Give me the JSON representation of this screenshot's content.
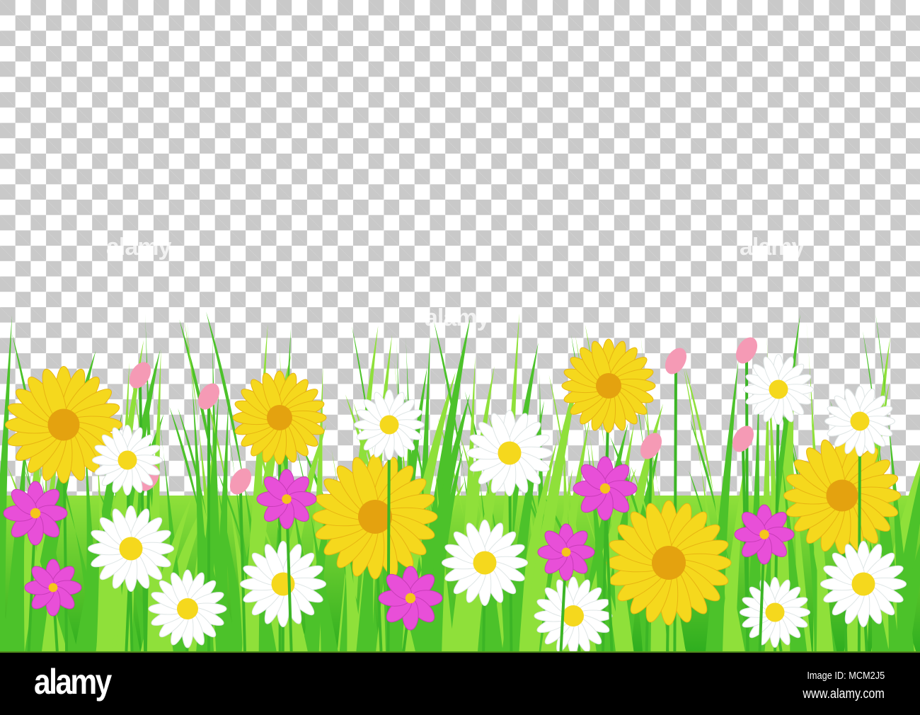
{
  "illustration": {
    "subject": "grass-and-flowers-border",
    "colors": {
      "checker_light": "#ffffff",
      "checker_dark": "#c9c9c9",
      "grass_dark": "#2fae1f",
      "grass_light": "#8fe03a",
      "daisy_yellow": "#f5d81d",
      "daisy_white": "#ffffff",
      "cosmos_pink": "#e84fd8",
      "bud_pink": "#f59ab5"
    }
  },
  "watermark": {
    "text": "alamy"
  },
  "footer": {
    "logo": "alamy",
    "image_id": "Image ID: MCM2J5",
    "url": "www.alamy.com"
  }
}
